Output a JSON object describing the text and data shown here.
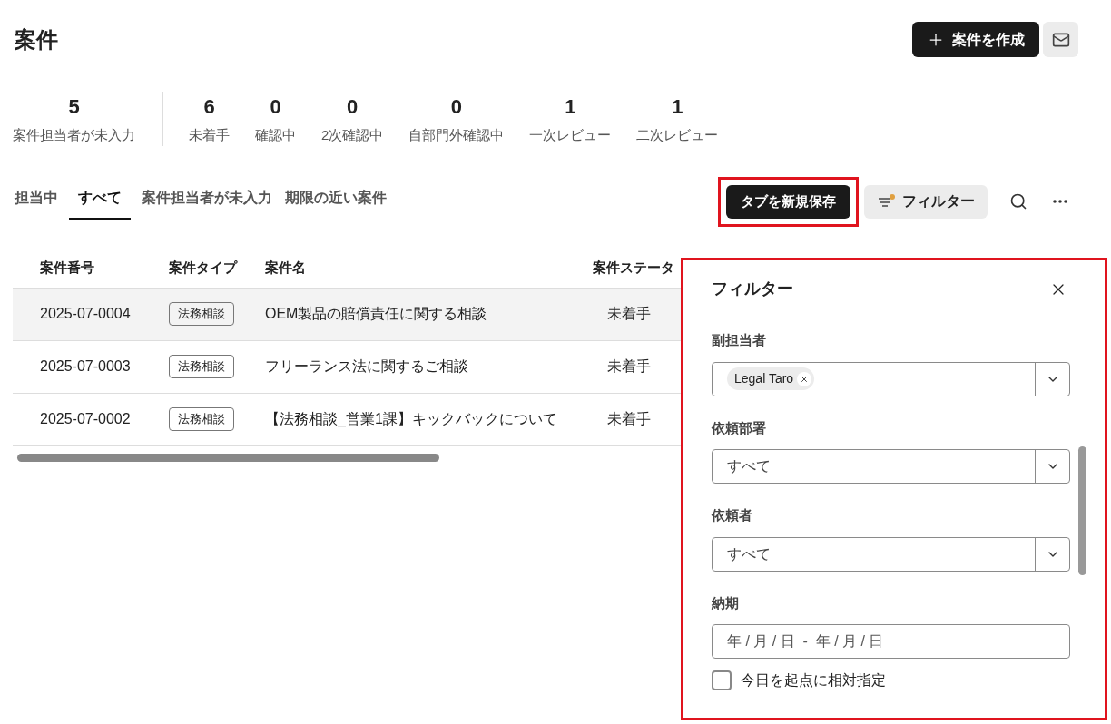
{
  "page": {
    "title": "案件"
  },
  "header_actions": {
    "create_button": "案件を作成"
  },
  "summary": {
    "value": "5",
    "label": "案件担当者が未入力"
  },
  "statuses": [
    {
      "value": "6",
      "label": "未着手"
    },
    {
      "value": "0",
      "label": "確認中"
    },
    {
      "value": "0",
      "label": "2次確認中"
    },
    {
      "value": "0",
      "label": "自部門外確認中"
    },
    {
      "value": "1",
      "label": "一次レビュー"
    },
    {
      "value": "1",
      "label": "二次レビュー"
    }
  ],
  "tabs": [
    {
      "label": "担当中",
      "selected": false
    },
    {
      "label": "すべて",
      "selected": true
    },
    {
      "label": "案件担当者が未入力",
      "selected": false
    },
    {
      "label": "期限の近い案件",
      "selected": false
    }
  ],
  "toolbar": {
    "save_tab_button": {
      "label": "タブを新規保存",
      "highlighted": true
    },
    "filter_button": {
      "label": "フィルター",
      "active": true
    }
  },
  "table": {
    "columns": [
      "案件番号",
      "案件タイプ",
      "案件名",
      "案件ステータ"
    ],
    "rows": [
      {
        "number": "2025-07-0004",
        "type": "法務相談",
        "name": "OEM製品の賠償責任に関する相談",
        "status": "未着手",
        "selected": true
      },
      {
        "number": "2025-07-0003",
        "type": "法務相談",
        "name": "フリーランス法に関するご相談",
        "status": "未着手",
        "selected": false
      },
      {
        "number": "2025-07-0002",
        "type": "法務相談",
        "name": "【法務相談_営業1課】キックバックについて",
        "status": "未着手",
        "selected": false
      }
    ]
  },
  "filter_panel": {
    "title": "フィルター",
    "highlighted": true,
    "fields": [
      {
        "kind": "multiselect",
        "label": "副担当者",
        "chips": [
          "Legal Taro"
        ]
      },
      {
        "kind": "select",
        "label": "依頼部署",
        "value": "すべて"
      },
      {
        "kind": "select",
        "label": "依頼者",
        "value": "すべて"
      },
      {
        "kind": "daterange",
        "label": "納期",
        "placeholder": "年 / 月 / 日  -  年 / 月 / 日"
      }
    ],
    "relative_checkbox": {
      "label": "今日を起点に相対指定",
      "checked": false
    }
  }
}
